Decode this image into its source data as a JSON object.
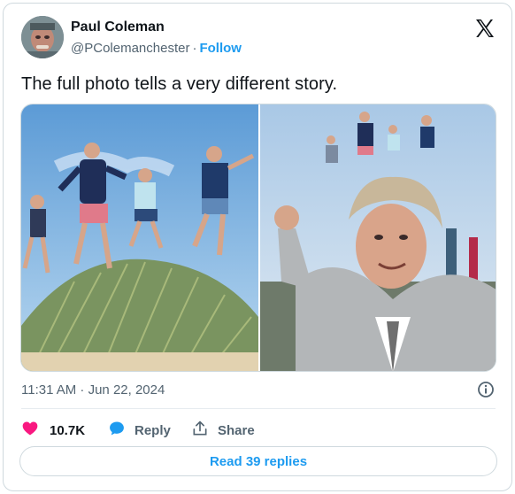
{
  "author": {
    "name": "Paul Coleman",
    "handle": "@PColemanchester",
    "separator": "·",
    "follow_label": "Follow"
  },
  "tweet": {
    "text": "The full photo tells a very different story."
  },
  "meta": {
    "timestamp": "11:31 AM · Jun 22, 2024"
  },
  "actions": {
    "like_count": "10.7K",
    "reply_label": "Reply",
    "share_label": "Share"
  },
  "replies_button": {
    "label": "Read 39 replies"
  },
  "colors": {
    "like": "#f91880",
    "reply": "#1d9bf0",
    "link": "#1d9bf0",
    "muted": "#536471"
  },
  "icons": {
    "brand": "x-logo-icon",
    "info": "info-icon",
    "like": "heart-icon",
    "reply": "speech-bubble-icon",
    "share": "share-icon"
  }
}
